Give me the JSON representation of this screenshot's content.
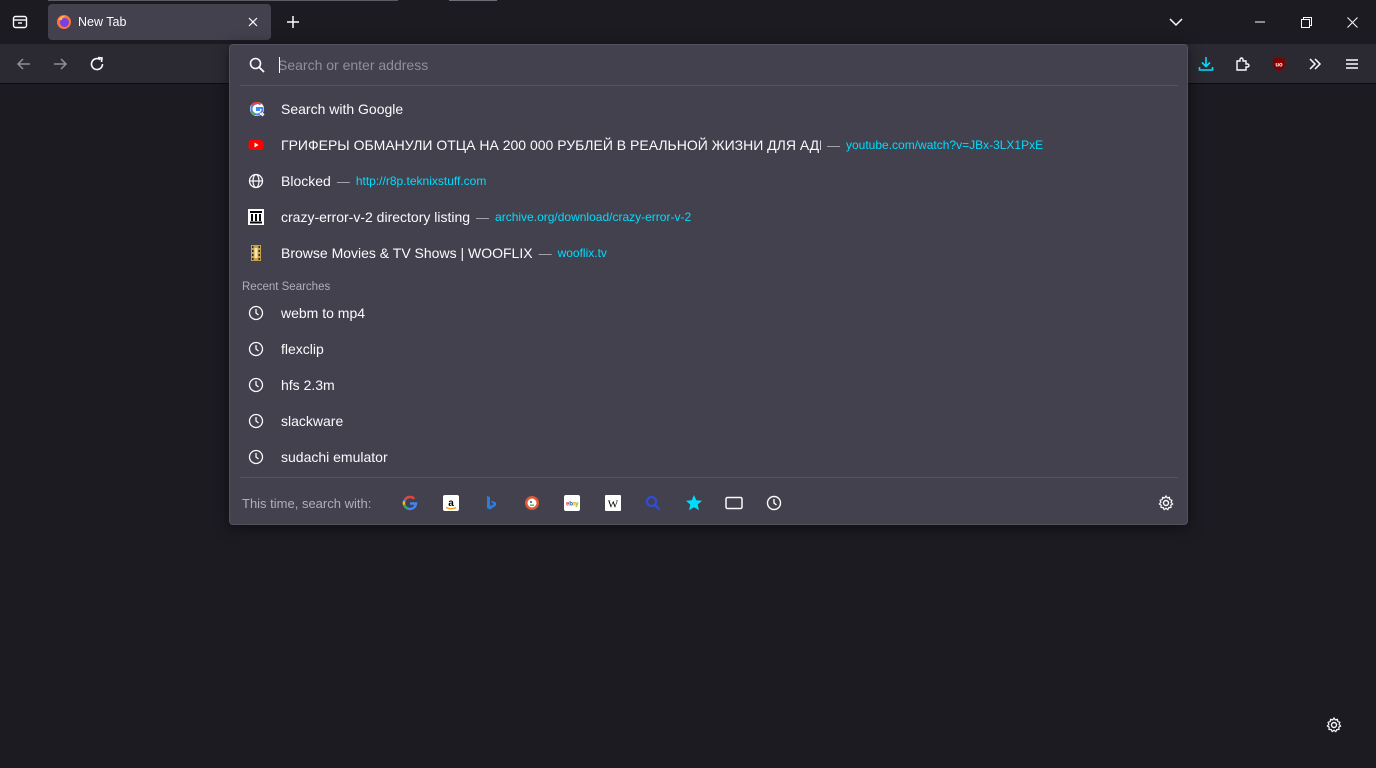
{
  "tabs": {
    "active": {
      "title": "New Tab"
    }
  },
  "urlbar": {
    "placeholder": "Search or enter address",
    "value": ""
  },
  "results": [
    {
      "title": "Search with Google",
      "url": "",
      "icon": "google-g-icon"
    },
    {
      "title": "ГРИФЕРЫ ОБМАНУЛИ ОТЦА НА 200 000 РУБЛЕЙ В РЕАЛЬНОЙ ЖИЗНИ ДЛЯ АДМ",
      "separator": "—",
      "url": "youtube.com/watch?v=JBx-3LX1PxE",
      "icon": "youtube-icon"
    },
    {
      "title": "Blocked",
      "separator": "—",
      "url": "http://r8p.teknixstuff.com",
      "icon": "globe-icon"
    },
    {
      "title": "crazy-error-v-2 directory listing",
      "separator": "—",
      "url": "archive.org/download/crazy-error-v-2",
      "icon": "archive-icon"
    },
    {
      "title": "Browse Movies & TV Shows | WOOFLIX",
      "separator": "—",
      "url": "wooflix.tv",
      "icon": "film-icon"
    }
  ],
  "recent_searches": {
    "label": "Recent Searches",
    "items": [
      "webm to mp4",
      "flexclip",
      "hfs 2.3m",
      "slackware",
      "sudachi emulator"
    ]
  },
  "oneoffs": {
    "label": "This time, search with:",
    "engines": [
      "google-icon",
      "amazon-icon",
      "bing-icon",
      "duckduckgo-icon",
      "ebay-icon",
      "wikipedia-icon",
      "search-icon",
      "bookmarks-star-icon",
      "tabs-icon",
      "history-clock-icon"
    ]
  },
  "colors": {
    "accent": "#00ddff",
    "popup_bg": "#42414d",
    "page_bg": "#1c1b22"
  }
}
